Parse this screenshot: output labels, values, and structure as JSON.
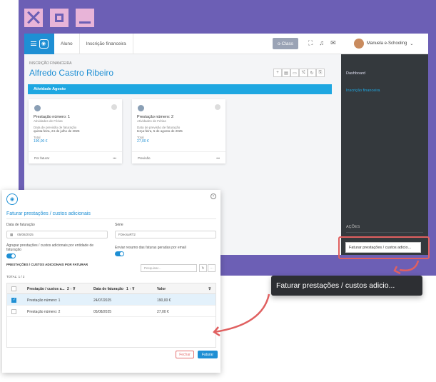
{
  "app": {
    "nav": [
      "Aluno",
      "Inscrição financeira"
    ],
    "oclass": "o-Class",
    "user": "Manuela e-Schooling",
    "section_label": "INSCRIÇÃO FINANCEIRA",
    "person_name": "Alfredo Castro Ribeiro",
    "activity": "Atividade Agosto",
    "cards": [
      {
        "title": "Prestação número: 1",
        "sub": "Atividades de Férias",
        "date_label": "Data de previsão de faturação",
        "date": "quinta-feira, 24 de julho de 2025",
        "total_label": "Total",
        "total": "190,00 €",
        "status": "Por faturar",
        "menu": "•••"
      },
      {
        "title": "Prestação número: 2",
        "sub": "Atividades de Férias",
        "date_label": "Data de previsão de faturação",
        "date": "terça-feira, 5 de agosto de 2025",
        "total_label": "Total",
        "total": "27,00 €",
        "status": "Previsão",
        "menu": "•••"
      }
    ],
    "sidebar": [
      "Dashboard",
      "Inscrição financeira"
    ],
    "actions_label": "AÇÕES",
    "action_button": "Faturar prestações / custos adicio..."
  },
  "tooltip": "Faturar prestações / custos adicio...",
  "dialog": {
    "title": "Faturar prestações / custos adicionais",
    "date_label": "Data de faturação",
    "date_value": "05/08/2025",
    "serie_label": "Série",
    "serie_value": "FDecsuRT2",
    "group_label": "Agrupar prestações / custos adicionais por entidade de faturação",
    "email_label": "Enviar resumo das faturas geradas por email",
    "section": "PRESTAÇÕES / CUSTOS ADICIONAIS POR FATURAR",
    "search_placeholder": "Pesquisar...",
    "total": "TOTAL: 1 / 2",
    "columns": [
      "Prestação / custos a...",
      "Data de faturação",
      "Valor"
    ],
    "col1_sort": "2 ↑ ⊽",
    "col2_sort": "1 ↑ ⊽",
    "col3_sort": "⊽",
    "rows": [
      {
        "name": "Prestação número: 1",
        "date": "24/07/2025",
        "value": "190,00 €"
      },
      {
        "name": "Prestação número: 2",
        "date": "05/08/2025",
        "value": "27,00 €"
      }
    ],
    "close": "Fechar",
    "submit": "Faturar"
  },
  "colors": {
    "accent": "#1e8fd4",
    "purple": "#6c5fb5",
    "highlight": "#e06060",
    "sidebar": "#34393d"
  }
}
